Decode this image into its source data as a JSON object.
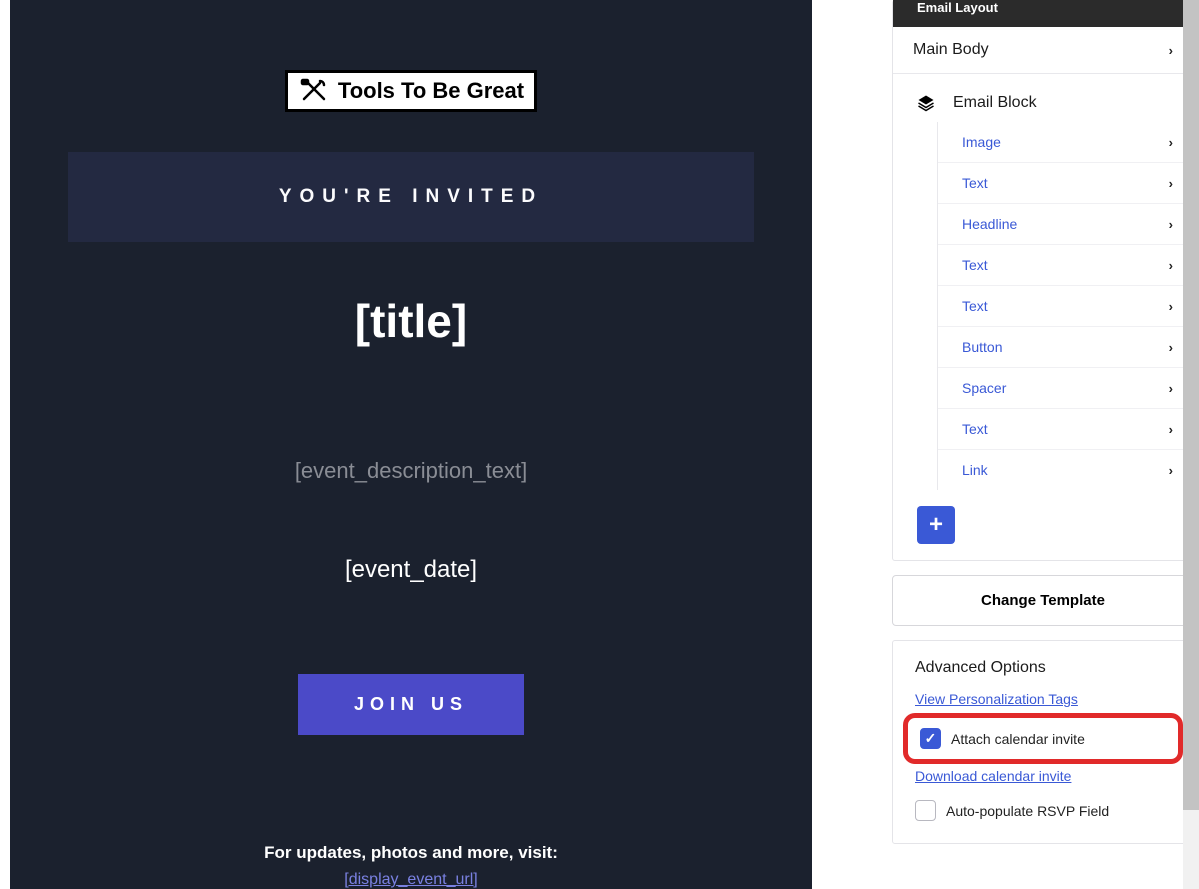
{
  "preview": {
    "logo_text": "Tools To Be Great",
    "invited_label": "YOU'RE INVITED",
    "title": "[title]",
    "description": "[event_description_text]",
    "event_date": "[event_date]",
    "join_button": "JOIN US",
    "footer_text": "For updates, photos and more, visit:",
    "footer_link": "[display_event_url]"
  },
  "sidebar": {
    "layout_header": "Email Layout",
    "main_body": "Main Body",
    "block_header": "Email Block",
    "blocks": {
      "b0": "Image",
      "b1": "Text",
      "b2": "Headline",
      "b3": "Text",
      "b4": "Text",
      "b5": "Button",
      "b6": "Spacer",
      "b7": "Text",
      "b8": "Link"
    },
    "change_template": "Change Template",
    "advanced": {
      "title": "Advanced Options",
      "view_tags": "View Personalization Tags",
      "attach_calendar": "Attach calendar invite",
      "download_calendar": "Download calendar invite",
      "auto_rsvp": "Auto-populate RSVP Field"
    }
  }
}
